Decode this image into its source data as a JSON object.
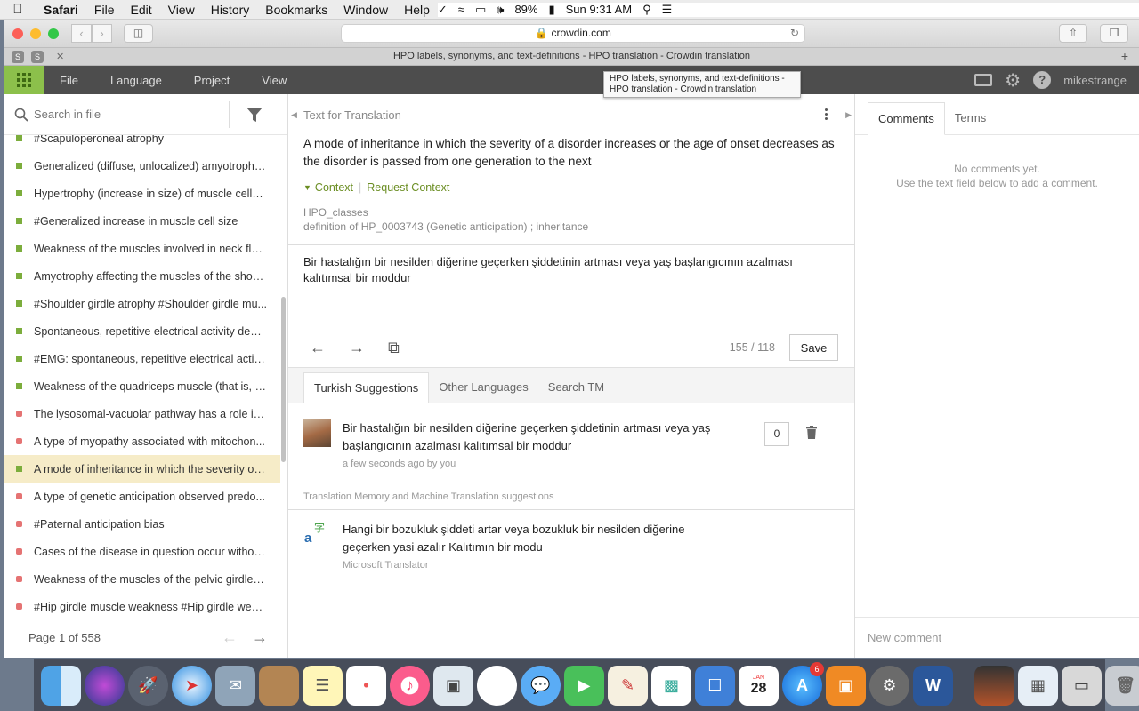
{
  "menubar": {
    "app": "Safari",
    "items": [
      "File",
      "Edit",
      "View",
      "History",
      "Bookmarks",
      "Window",
      "Help"
    ],
    "battery": "89%",
    "clock": "Sun 9:31 AM"
  },
  "browser": {
    "url": "crowdin.com",
    "pinned": [
      "S",
      "S"
    ],
    "tab_title": "HPO labels, synonyms, and text-definitions - HPO translation - Crowdin translation",
    "tooltip": "HPO labels, synonyms, and text-definitions - HPO translation - Crowdin translation"
  },
  "app": {
    "menu": [
      "File",
      "Language",
      "Project",
      "View"
    ],
    "username": "mikestrange"
  },
  "left": {
    "search_placeholder": "Search in file",
    "items": [
      {
        "text": "#Scapuloperoneal atrophy",
        "status": "green",
        "active": false
      },
      {
        "text": "Generalized (diffuse, unlocalized) amyotrophy ...",
        "status": "green",
        "active": false
      },
      {
        "text": "Hypertrophy (increase in size) of muscle cells i...",
        "status": "green",
        "active": false
      },
      {
        "text": "#Generalized increase in muscle cell size",
        "status": "green",
        "active": false
      },
      {
        "text": "Weakness of the muscles involved in neck flexi...",
        "status": "green",
        "active": false
      },
      {
        "text": "Amyotrophy affecting the muscles of the shoul...",
        "status": "green",
        "active": false
      },
      {
        "text": "#Shoulder girdle atrophy #Shoulder girdle mu...",
        "status": "green",
        "active": false
      },
      {
        "text": "Spontaneous, repetitive electrical activity dem...",
        "status": "green",
        "active": false
      },
      {
        "text": "#EMG: spontaneous, repetitive electrical activity",
        "status": "green",
        "active": false
      },
      {
        "text": "Weakness of the quadriceps muscle (that is, of...",
        "status": "green",
        "active": false
      },
      {
        "text": "The lysosomal-vacuolar pathway has a role in t...",
        "status": "red",
        "active": false
      },
      {
        "text": "A type of myopathy associated with mitochon...",
        "status": "red",
        "active": false
      },
      {
        "text": "A mode of inheritance in which the severity of ...",
        "status": "green",
        "active": true
      },
      {
        "text": "A type of genetic anticipation observed predo...",
        "status": "red",
        "active": false
      },
      {
        "text": "#Paternal anticipation bias",
        "status": "red",
        "active": false
      },
      {
        "text": "Cases of the disease in question occur without...",
        "status": "red",
        "active": false
      },
      {
        "text": "Weakness of the muscles of the pelvic girdle (a...",
        "status": "red",
        "active": false
      },
      {
        "text": "#Hip girdle muscle weakness #Hip girdle weak...",
        "status": "red",
        "active": false
      }
    ],
    "pager": "Page 1 of 558"
  },
  "center": {
    "header": "Text for Translation",
    "source": "A mode of inheritance in which the severity of a disorder increases or the age of onset decreases as the disorder is passed from one generation to the next",
    "context_label": "Context",
    "request_context": "Request Context",
    "context_file": "HPO_classes",
    "context_detail": "definition of HP_0003743 (Genetic anticipation) ; inheritance",
    "translation": "Bir hastalığın bir nesilden diğerine geçerken şiddetinin artması veya yaş başlangıcının azalması kalıtımsal bir moddur",
    "char_count": "155 / 118",
    "save_label": "Save",
    "tabs": [
      "Turkish Suggestions",
      "Other Languages",
      "Search TM"
    ],
    "suggestion": {
      "text": "Bir hastalığın bir nesilden diğerine geçerken şiddetinin artması veya yaş başlangıcının azalması kalıtımsal bir moddur",
      "meta": "a few seconds ago by you",
      "votes": "0"
    },
    "tm_label": "Translation Memory and Machine Translation suggestions",
    "mt": {
      "text": "Hangi bir bozukluk şiddeti artar veya bozukluk bir nesilden diğerine geçerken yasi azalır Kalıtımın bir modu",
      "source": "Microsoft Translator"
    }
  },
  "right": {
    "tabs": [
      "Comments",
      "Terms"
    ],
    "empty_line1": "No comments yet.",
    "empty_line2": "Use the text field below to add a comment.",
    "new_comment_placeholder": "New comment"
  },
  "dock": {
    "calendar_month": "JAN",
    "calendar_day": "28",
    "appstore_badge": "6"
  }
}
